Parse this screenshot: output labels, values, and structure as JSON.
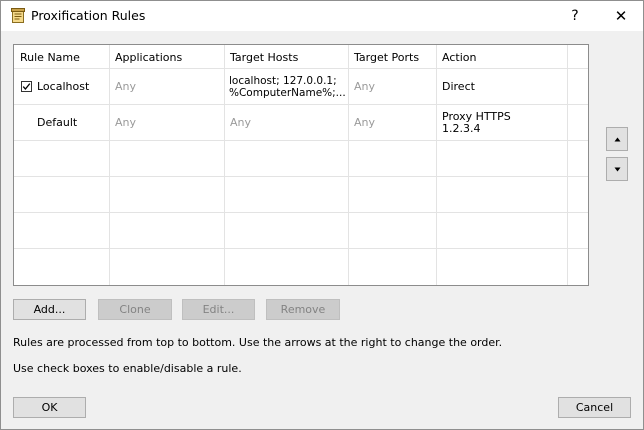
{
  "window": {
    "title": "Proxification Rules",
    "help_glyph": "?",
    "close_glyph": "✕"
  },
  "grid": {
    "columns": [
      "Rule Name",
      "Applications",
      "Target Hosts",
      "Target Ports",
      "Action"
    ],
    "rows": [
      {
        "checked": true,
        "name": "Localhost",
        "applications": "Any",
        "target_hosts": "localhost; 127.0.0.1;\n%ComputerName%;...",
        "target_ports": "Any",
        "action": "Direct"
      },
      {
        "checked": null,
        "name": "Default",
        "applications": "Any",
        "target_hosts": "Any",
        "target_ports": "Any",
        "action": "Proxy HTTPS\n1.2.3.4"
      }
    ]
  },
  "buttons": {
    "add": "Add...",
    "clone": "Clone",
    "edit": "Edit...",
    "remove": "Remove",
    "ok": "OK",
    "cancel": "Cancel"
  },
  "info": {
    "line1": "Rules are processed from top to bottom. Use the arrows at the right to change the order.",
    "line2": "Use check boxes to enable/disable a rule."
  },
  "icons": {
    "title_icon": "proxifier-rules-icon",
    "move_up": "triangle-up-icon",
    "move_down": "triangle-down-icon"
  },
  "colors": {
    "window_bg": "#f0f0f0",
    "grid_bg": "#ffffff",
    "gray_text": "#9a9a9a",
    "disabled_button": "#cccccc"
  }
}
